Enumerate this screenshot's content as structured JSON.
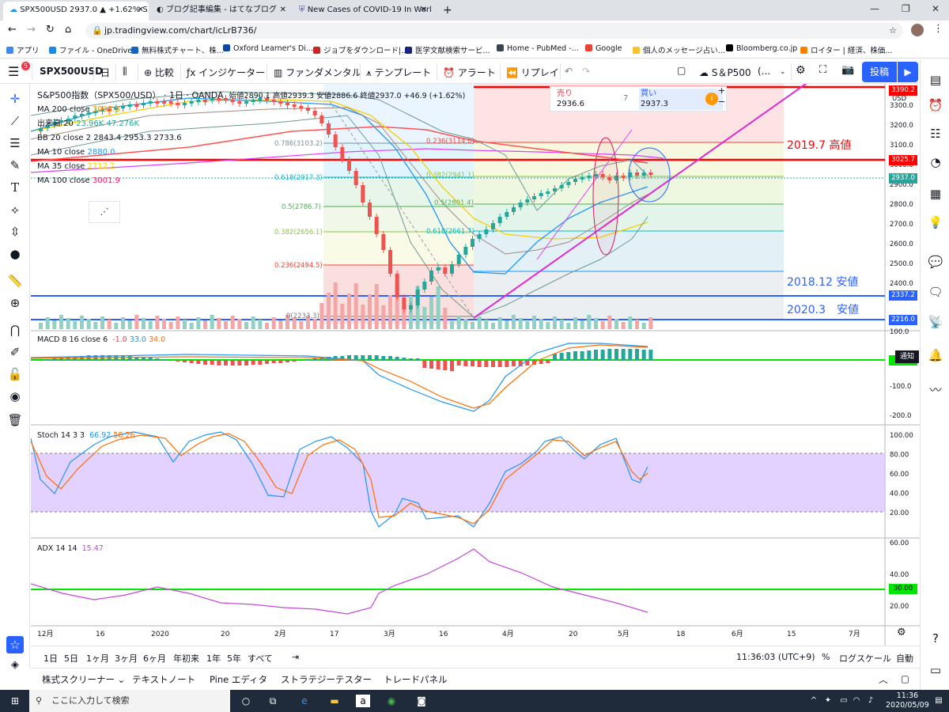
{
  "browser": {
    "tabs": [
      {
        "title": "SPX500USD 2937.0 ▲ +1.62% S"
      },
      {
        "title": "ブログ記事編集 - はてなブログ"
      },
      {
        "title": "New Cases of COVID-19 In Worl"
      }
    ],
    "new_tab": "+",
    "url": "jp.tradingview.com/chart/icLrB736/",
    "bookmarks": [
      "アプリ",
      "ファイル - OneDrive",
      "無料株式チャート、株...",
      "Oxford Learner's Di...",
      "ジョブをダウンロード|...",
      "医学文献検索サービ...",
      "Home - PubMed -...",
      "Google",
      "個人のメッセージ占い...",
      "Bloomberg.co.jp",
      "ロイター | 経済、株価..."
    ]
  },
  "toolbar": {
    "symbol": "SPX500USD",
    "interval": "日",
    "compare": "比較",
    "indicators": "インジケーター",
    "fundamentals": "ファンダメンタル",
    "templates": "テンプレート",
    "alert": "アラート",
    "replay": "リプレイ",
    "layout_name": "S＆P500",
    "layout_more": "(...",
    "post": "投稿",
    "notification_badge": "5"
  },
  "legend": {
    "title": "S&P500指数（SPX500/USD） · 1日 · OANDA",
    "ohlc": "始値2890.1  高値2939.3  安値2886.6  終値2937.0  +46.9 (+1.62%)",
    "rows": [
      {
        "label": "MA 200 close",
        "value": "3003.8",
        "color": "#ff9800"
      },
      {
        "label": "出来高 20",
        "value": "23.96K  47.276K",
        "color": "#26a69a"
      },
      {
        "label": "BB 20 close 2",
        "value": "2843.4  2953.3  2733.6",
        "color": "#131722"
      },
      {
        "label": "MA 10 close",
        "value": "2880.0",
        "color": "#2196f3"
      },
      {
        "label": "MA 35 close",
        "value": "2712.2",
        "color": "#f5d000"
      },
      {
        "label": "MA 100 close",
        "value": "3001.9",
        "color": "#e91e63"
      }
    ]
  },
  "buysell": {
    "sell_label": "売り",
    "sell_price": "2936.6",
    "spread": "7",
    "buy_label": "買い",
    "buy_price": "2937.3"
  },
  "fib_labels": [
    "0.786(3103.2)",
    "0.618(2917.3)",
    "0.5(2786.7)",
    "0.382(2656.1)",
    "0.236(2494.5)",
    "0(2233.3)",
    "0.236(3114.0)",
    "0.382(2941.1)",
    "0.5(2801.4)",
    "0.618(2661.7)"
  ],
  "annotations": {
    "high_2019": "2019.7  高値",
    "low_2018": "2018.12 安値",
    "low_2020": "2020.3　安値"
  },
  "price_axis": {
    "unit": "USD",
    "ticks": [
      "3300.0",
      "3200.0",
      "3100.0",
      "3000.0",
      "2900.0",
      "2800.0",
      "2700.0",
      "2600.0",
      "2500.0",
      "2400.0"
    ],
    "labels": {
      "high": "3025.7",
      "current": "2937.0",
      "low_2018": "2337.2",
      "low_2020": "2216.0",
      "top": "3390.2"
    }
  },
  "macd": {
    "title": "MACD 8 16 close 6",
    "v1": "-1.0",
    "v2": "33.0",
    "v3": "34.0",
    "ticks": [
      "100.0",
      "-100.0",
      "-200.0"
    ],
    "zero": "0.00",
    "notify": "通知"
  },
  "stoch": {
    "title": "Stoch 14 3 3",
    "k": "66.92",
    "d": "58.26",
    "ticks": [
      "100.00",
      "80.00",
      "60.00",
      "40.00",
      "20.00"
    ]
  },
  "adx": {
    "title": "ADX 14 14",
    "value": "15.47",
    "ticks": [
      "60.00",
      "40.00",
      "20.00"
    ],
    "level": "30.00"
  },
  "time_axis": [
    "12月",
    "16",
    "2020",
    "20",
    "2月",
    "17",
    "3月",
    "16",
    "4月",
    "20",
    "5月",
    "18",
    "6月",
    "15",
    "7月"
  ],
  "ranges": [
    "1日",
    "5日",
    "1ヶ月",
    "3ヶ月",
    "6ヶ月",
    "年初来",
    "1年",
    "5年",
    "すべて"
  ],
  "status": {
    "clock": "11:36:03 (UTC+9)",
    "percent": "%",
    "log": "ログスケール",
    "auto": "自動"
  },
  "bottom_tabs": [
    "株式スクリーナー",
    "テキストノート",
    "Pine エディタ",
    "ストラテジーテスター",
    "トレードパネル"
  ],
  "taskbar": {
    "search_placeholder": "ここに入力して検索",
    "time": "11:36",
    "date": "2020/05/09"
  },
  "colors": {
    "accent": "#2962ff",
    "red_line": "#ff0000",
    "blue_line": "#2962ff",
    "stoch_band": "#d1b3ff",
    "green_line": "#00e600"
  }
}
